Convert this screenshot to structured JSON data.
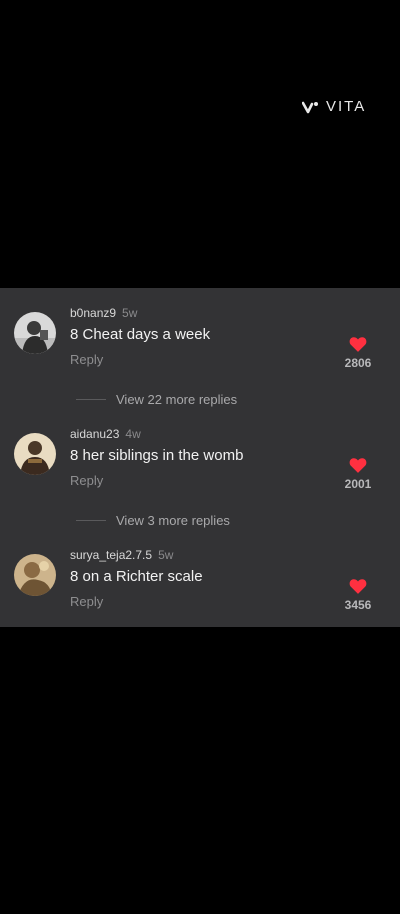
{
  "watermark": {
    "text": "VITA",
    "icon": "vita-logo-icon"
  },
  "comments": [
    {
      "username": "b0nanz9",
      "age": "5w",
      "text": "8 Cheat days a week",
      "reply_label": "Reply",
      "likes": "2806",
      "like_icon": "heart-icon",
      "like_color": "#ff3040"
    },
    {
      "username": "aidanu23",
      "age": "4w",
      "text": "8 her siblings in the womb",
      "reply_label": "Reply",
      "likes": "2001",
      "like_icon": "heart-icon",
      "like_color": "#ff3040"
    },
    {
      "username": "surya_teja2.7.5",
      "age": "5w",
      "text": "8 on a Richter scale",
      "reply_label": "Reply",
      "likes": "3456",
      "like_icon": "heart-icon",
      "like_color": "#ff3040"
    }
  ],
  "view_more": [
    {
      "label": "View 22 more replies"
    },
    {
      "label": "View 3 more replies"
    }
  ],
  "colors": {
    "background": "#000000",
    "panel": "#333335",
    "heart": "#ff3040"
  }
}
